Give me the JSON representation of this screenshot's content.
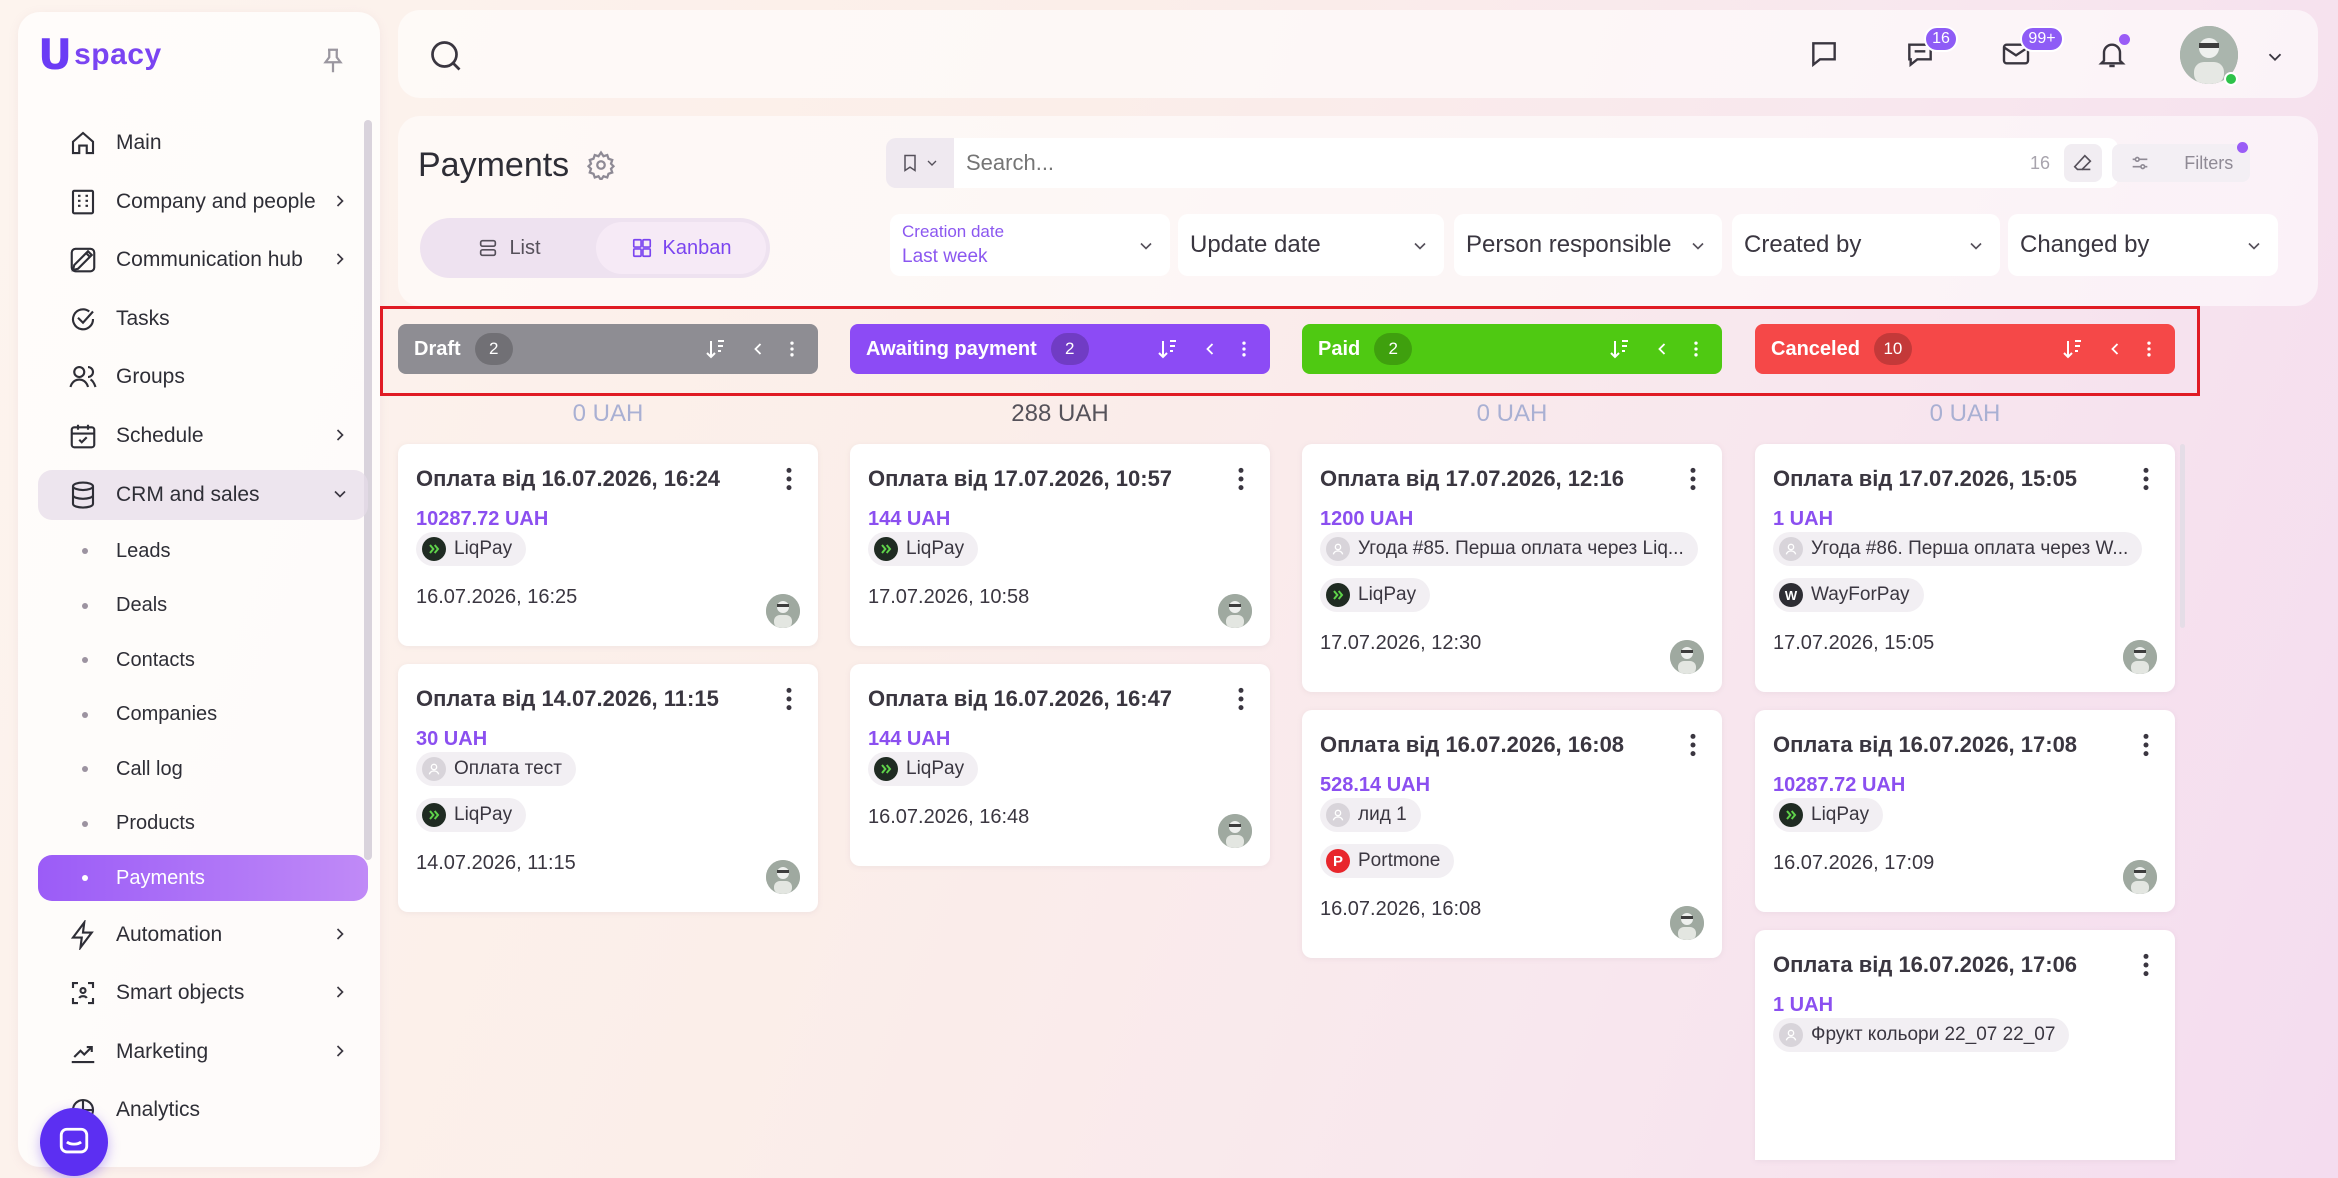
{
  "app": {
    "logo_text": "spacy"
  },
  "sidebar": {
    "items": [
      {
        "label": "Main",
        "icon": "home-icon",
        "chevron": false
      },
      {
        "label": "Company and people",
        "icon": "building-icon",
        "chevron": true
      },
      {
        "label": "Communication hub",
        "icon": "hub-icon",
        "chevron": true
      },
      {
        "label": "Tasks",
        "icon": "check-circle-icon",
        "chevron": false
      },
      {
        "label": "Groups",
        "icon": "users-icon",
        "chevron": false
      },
      {
        "label": "Schedule",
        "icon": "calendar-icon",
        "chevron": true
      },
      {
        "label": "CRM and sales",
        "icon": "database-icon",
        "chevron": true,
        "open": true
      }
    ],
    "sub_items": [
      "Leads",
      "Deals",
      "Contacts",
      "Companies",
      "Call log",
      "Products",
      "Payments"
    ],
    "active_sub": "Payments",
    "items_after": [
      {
        "label": "Automation",
        "icon": "lightning-icon"
      },
      {
        "label": "Smart objects",
        "icon": "scan-icon"
      },
      {
        "label": "Marketing",
        "icon": "marketing-icon"
      },
      {
        "label": "Analytics",
        "icon": "analytics-icon"
      }
    ]
  },
  "topbar": {
    "chat_badge": "16",
    "mail_badge": "99+"
  },
  "header": {
    "title": "Payments",
    "view_list": "List",
    "view_kanban": "Kanban",
    "search_placeholder": "Search...",
    "search_count": "16",
    "filters_label": "Filters",
    "filters": {
      "creation_label": "Creation date",
      "creation_value": "Last week",
      "update": "Update date",
      "person": "Person responsible",
      "created_by": "Created by",
      "changed_by": "Changed by"
    }
  },
  "columns": [
    {
      "name": "Draft",
      "count": "2",
      "sum": "0 UAH",
      "color": "#8e8d93",
      "sum_color": "#a9b0d3",
      "cards": [
        {
          "title": "Оплата від 16.07.2026, 16:24",
          "amount": "10287.72 UAH",
          "chips": [
            {
              "text": "LiqPay",
              "type": "liqpay"
            }
          ],
          "date": "16.07.2026, 16:25"
        },
        {
          "title": "Оплата від 14.07.2026, 11:15",
          "amount": "30 UAH",
          "chips": [
            {
              "text": "Оплата тест",
              "type": "person"
            },
            {
              "text": "LiqPay",
              "type": "liqpay"
            }
          ],
          "date": "14.07.2026, 11:15"
        }
      ]
    },
    {
      "name": "Awaiting payment",
      "count": "2",
      "sum": "288 UAH",
      "color": "#8c4bf5",
      "sum_color": "#55525a",
      "cards": [
        {
          "title": "Оплата від 17.07.2026, 10:57",
          "amount": "144 UAH",
          "chips": [
            {
              "text": "LiqPay",
              "type": "liqpay"
            }
          ],
          "date": "17.07.2026, 10:58"
        },
        {
          "title": "Оплата від 16.07.2026, 16:47",
          "amount": "144 UAH",
          "chips": [
            {
              "text": "LiqPay",
              "type": "liqpay"
            }
          ],
          "date": "16.07.2026, 16:48"
        }
      ]
    },
    {
      "name": "Paid",
      "count": "2",
      "sum": "0 UAH",
      "color": "#4fc912",
      "sum_color": "#a9b0d3",
      "cards": [
        {
          "title": "Оплата від 17.07.2026, 12:16",
          "amount": "1200 UAH",
          "chips": [
            {
              "text": "Угода #85. Перша оплата через Liq...",
              "type": "person"
            },
            {
              "text": "LiqPay",
              "type": "liqpay"
            }
          ],
          "date": "17.07.2026, 12:30"
        },
        {
          "title": "Оплата від 16.07.2026, 16:08",
          "amount": "528.14 UAH",
          "chips": [
            {
              "text": "лид 1",
              "type": "person"
            },
            {
              "text": "Portmone",
              "type": "portmone"
            }
          ],
          "date": "16.07.2026, 16:08"
        }
      ]
    },
    {
      "name": "Canceled",
      "count": "10",
      "sum": "0 UAH",
      "color": "#f54848",
      "sum_color": "#a9b0d3",
      "cards": [
        {
          "title": "Оплата від 17.07.2026, 15:05",
          "amount": "1 UAH",
          "chips": [
            {
              "text": "Угода #86. Перша оплата через W...",
              "type": "person"
            },
            {
              "text": "WayForPay",
              "type": "wayforpay"
            }
          ],
          "date": "17.07.2026, 15:05"
        },
        {
          "title": "Оплата від 16.07.2026, 17:08",
          "amount": "10287.72 UAH",
          "chips": [
            {
              "text": "LiqPay",
              "type": "liqpay"
            }
          ],
          "date": "16.07.2026, 17:09"
        },
        {
          "title": "Оплата від 16.07.2026, 17:06",
          "amount": "1 UAH",
          "chips": [
            {
              "text": "Фрукт кольори 22_07 22_07",
              "type": "person"
            }
          ],
          "date": ""
        }
      ]
    }
  ],
  "colors": {
    "accent": "#8b4ff0",
    "highlight": "#e01b24"
  }
}
